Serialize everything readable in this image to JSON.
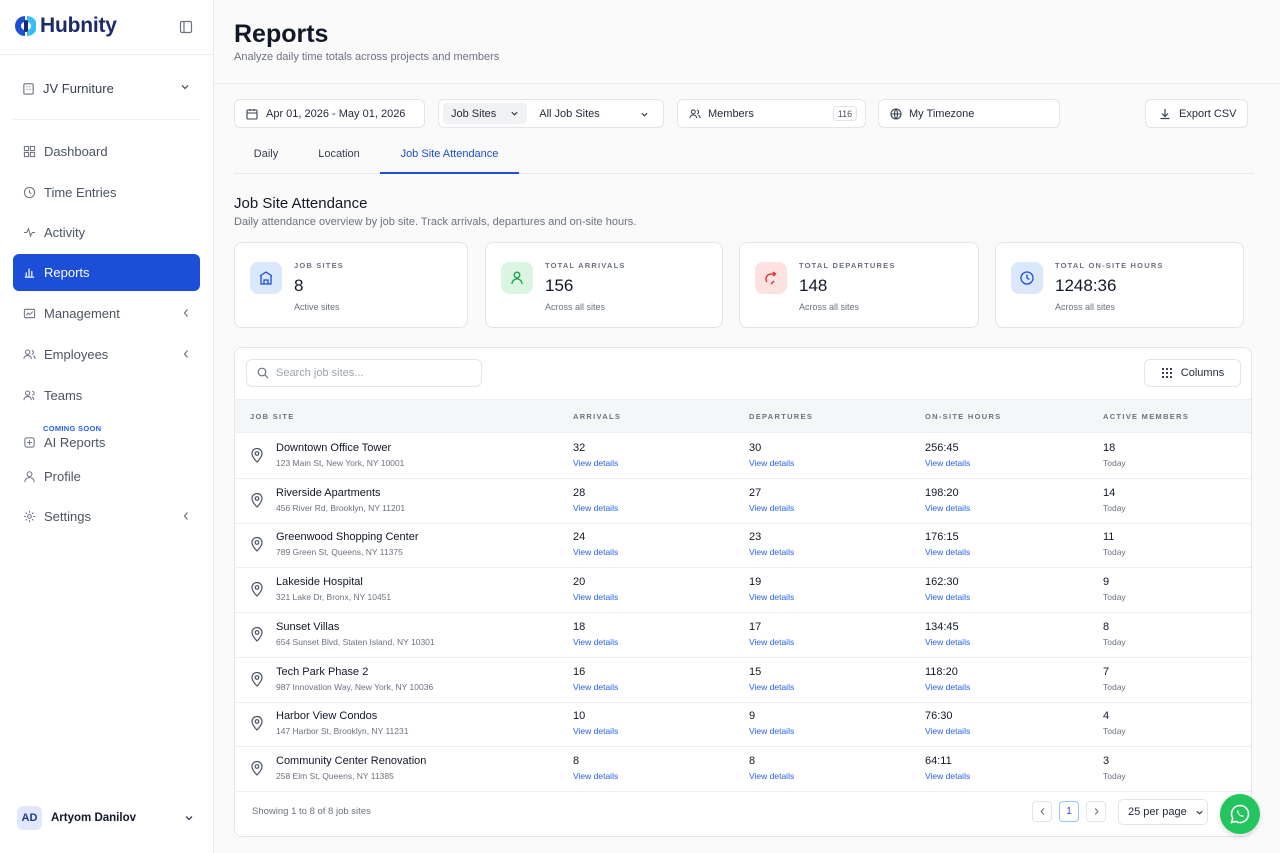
{
  "brand": {
    "name": "Hubnity",
    "color": "#1b2a6b",
    "accent": "#1d4ed8"
  },
  "sidebar": {
    "organization": "JV Furniture",
    "items": [
      {
        "label": "Dashboard",
        "icon": "grid-icon"
      },
      {
        "label": "Time Entries",
        "icon": "clock-history-icon"
      },
      {
        "label": "Activity",
        "icon": "activity-icon"
      },
      {
        "label": "Reports",
        "icon": "bar-chart-icon",
        "active": true
      },
      {
        "label": "Management",
        "icon": "briefcase-icon",
        "expandable": true
      },
      {
        "label": "Employees",
        "icon": "users-icon",
        "expandable": true
      },
      {
        "label": "Teams",
        "icon": "team-icon"
      },
      {
        "label": "AI Reports",
        "icon": "sparkle-icon",
        "badge": "COMING SOON"
      },
      {
        "label": "Profile",
        "icon": "user-icon"
      },
      {
        "label": "Settings",
        "icon": "gear-icon",
        "expandable": true
      }
    ],
    "user": {
      "initials": "AD",
      "name": "Artyom Danilov"
    }
  },
  "header": {
    "title": "Reports",
    "subtitle": "Analyze daily time totals across projects and members"
  },
  "filters": {
    "date_range": "Apr 01, 2026 - May 01, 2026",
    "scope_label": "Job Sites",
    "scope_value": "All Job Sites",
    "members_label": "Members",
    "members_count": "116",
    "timezone": "My Timezone",
    "export_label": "Export CSV"
  },
  "tabs": [
    "Daily",
    "Location",
    "Job Site Attendance"
  ],
  "active_tab": "Job Site Attendance",
  "section": {
    "title": "Job Site Attendance",
    "subtitle": "Daily attendance overview by job site. Track arrivals, departures and on-site hours."
  },
  "stats": [
    {
      "label": "JOB SITES",
      "value": "8",
      "sub": "Active sites",
      "icon": "building-icon",
      "color": "#dbe7fb"
    },
    {
      "label": "TOTAL ARRIVALS",
      "value": "156",
      "sub": "Across all sites",
      "icon": "person-arrive-icon",
      "color": "#dcf5e3"
    },
    {
      "label": "TOTAL DEPARTURES",
      "value": "148",
      "sub": "Across all sites",
      "icon": "exit-arrow-icon",
      "color": "#fde2e2"
    },
    {
      "label": "TOTAL ON-SITE HOURS",
      "value": "1248:36",
      "sub": "Across all sites",
      "icon": "clock-icon",
      "color": "#dbe7fb"
    }
  ],
  "table": {
    "search_placeholder": "Search job sites...",
    "columns_label": "Columns",
    "headers": [
      "JOB SITE",
      "ARRIVALS",
      "DEPARTURES",
      "ON-SITE HOURS",
      "ACTIVE MEMBERS"
    ],
    "link_label": "View details",
    "today_label": "Today",
    "rows": [
      {
        "name": "Downtown Office Tower",
        "address": "123 Main St, New York, NY 10001",
        "arrivals": "32",
        "departures": "30",
        "hours": "256:45",
        "members": "18"
      },
      {
        "name": "Riverside Apartments",
        "address": "456 River Rd, Brooklyn, NY 11201",
        "arrivals": "28",
        "departures": "27",
        "hours": "198:20",
        "members": "14"
      },
      {
        "name": "Greenwood Shopping Center",
        "address": "789 Green St, Queens, NY 11375",
        "arrivals": "24",
        "departures": "23",
        "hours": "176:15",
        "members": "11"
      },
      {
        "name": "Lakeside Hospital",
        "address": "321 Lake Dr, Bronx, NY 10451",
        "arrivals": "20",
        "departures": "19",
        "hours": "162:30",
        "members": "9"
      },
      {
        "name": "Sunset Villas",
        "address": "654 Sunset Blvd, Staten Island, NY 10301",
        "arrivals": "18",
        "departures": "17",
        "hours": "134:45",
        "members": "8"
      },
      {
        "name": "Tech Park Phase 2",
        "address": "987 Innovation Way, New York, NY 10036",
        "arrivals": "16",
        "departures": "15",
        "hours": "118:20",
        "members": "7"
      },
      {
        "name": "Harbor View Condos",
        "address": "147 Harbor St, Brooklyn, NY 11231",
        "arrivals": "10",
        "departures": "9",
        "hours": "76:30",
        "members": "4"
      },
      {
        "name": "Community Center Renovation",
        "address": "258 Elm St, Queens, NY 11385",
        "arrivals": "8",
        "departures": "8",
        "hours": "64:11",
        "members": "3"
      }
    ],
    "footer_text": "Showing 1 to 8 of 8 job sites",
    "current_page": "1",
    "per_page": "25 per page"
  }
}
